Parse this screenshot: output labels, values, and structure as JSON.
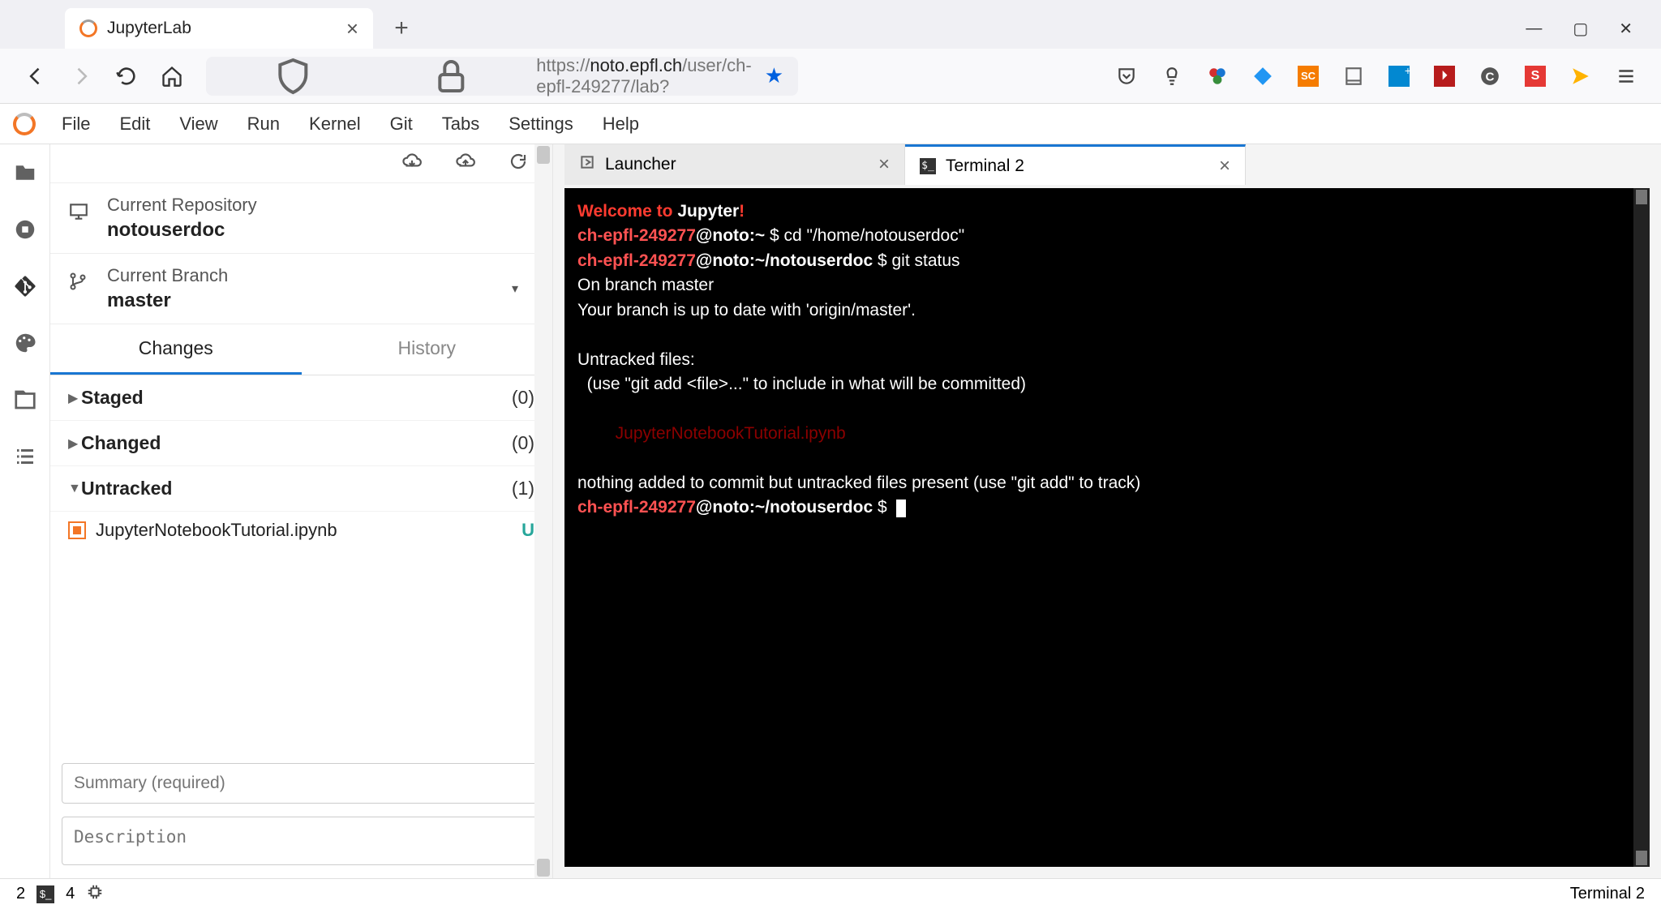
{
  "browser": {
    "tab_title": "JupyterLab",
    "url_prefix": "https://",
    "url_domain": "noto.epfl.ch",
    "url_path": "/user/ch-epfl-249277/lab?"
  },
  "jlab": {
    "menus": [
      "File",
      "Edit",
      "View",
      "Run",
      "Kernel",
      "Git",
      "Tabs",
      "Settings",
      "Help"
    ]
  },
  "git": {
    "repo_label": "Current Repository",
    "repo_name": "notouserdoc",
    "branch_label": "Current Branch",
    "branch_name": "master",
    "tabs": {
      "changes": "Changes",
      "history": "History"
    },
    "sections": {
      "staged": {
        "label": "Staged",
        "count": "(0)",
        "open": false
      },
      "changed": {
        "label": "Changed",
        "count": "(0)",
        "open": false
      },
      "untracked": {
        "label": "Untracked",
        "count": "(1)",
        "open": true
      }
    },
    "untracked_files": [
      {
        "name": "JupyterNotebookTutorial.ipynb",
        "status": "U"
      }
    ],
    "summary_placeholder": "Summary (required)",
    "description_placeholder": "Description"
  },
  "tabs": {
    "launcher": "Launcher",
    "terminal": "Terminal 2"
  },
  "terminal": {
    "welcome1": "Welcome to ",
    "welcome2": "Jupyter",
    "welcome3": "!",
    "user": "ch-epfl-249277",
    "host_home": "@noto:~",
    "host_dir": "@noto:~/notouserdoc",
    "dollar": " $ ",
    "cmd1": "cd \"/home/notouserdoc\"",
    "cmd2": "git status",
    "out_branch": "On branch master",
    "out_uptodate": "Your branch is up to date with 'origin/master'.",
    "out_untracked_hdr": "Untracked files:",
    "out_untracked_hint": "  (use \"git add <file>...\" to include in what will be committed)",
    "out_untracked_file": "        JupyterNotebookTutorial.ipynb",
    "out_nothing": "nothing added to commit but untracked files present (use \"git add\" to track)"
  },
  "status": {
    "num1": "2",
    "num2": "4",
    "right": "Terminal 2"
  }
}
